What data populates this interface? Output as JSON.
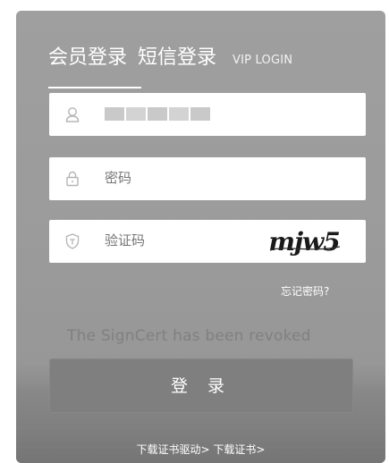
{
  "tabs": {
    "member_login": "会员登录",
    "sms_login": "短信登录",
    "vip_login": "VIP LOGIN"
  },
  "fields": {
    "username": {
      "icon": "user-icon",
      "value": ""
    },
    "password": {
      "icon": "lock-icon",
      "placeholder": "密码"
    },
    "captcha": {
      "icon": "shield-icon",
      "placeholder": "验证码",
      "captcha_text": "mjw5"
    }
  },
  "forgot_password": "忘记密码?",
  "error_message": "The SignCert has been revoked",
  "login_button": "登 录",
  "footer": {
    "download_driver": "下载证书驱动>",
    "download_cert": "下载证书>"
  },
  "colors": {
    "background": "#9b9b9b",
    "button": "#7f7f7f",
    "error_text": "#808080"
  }
}
